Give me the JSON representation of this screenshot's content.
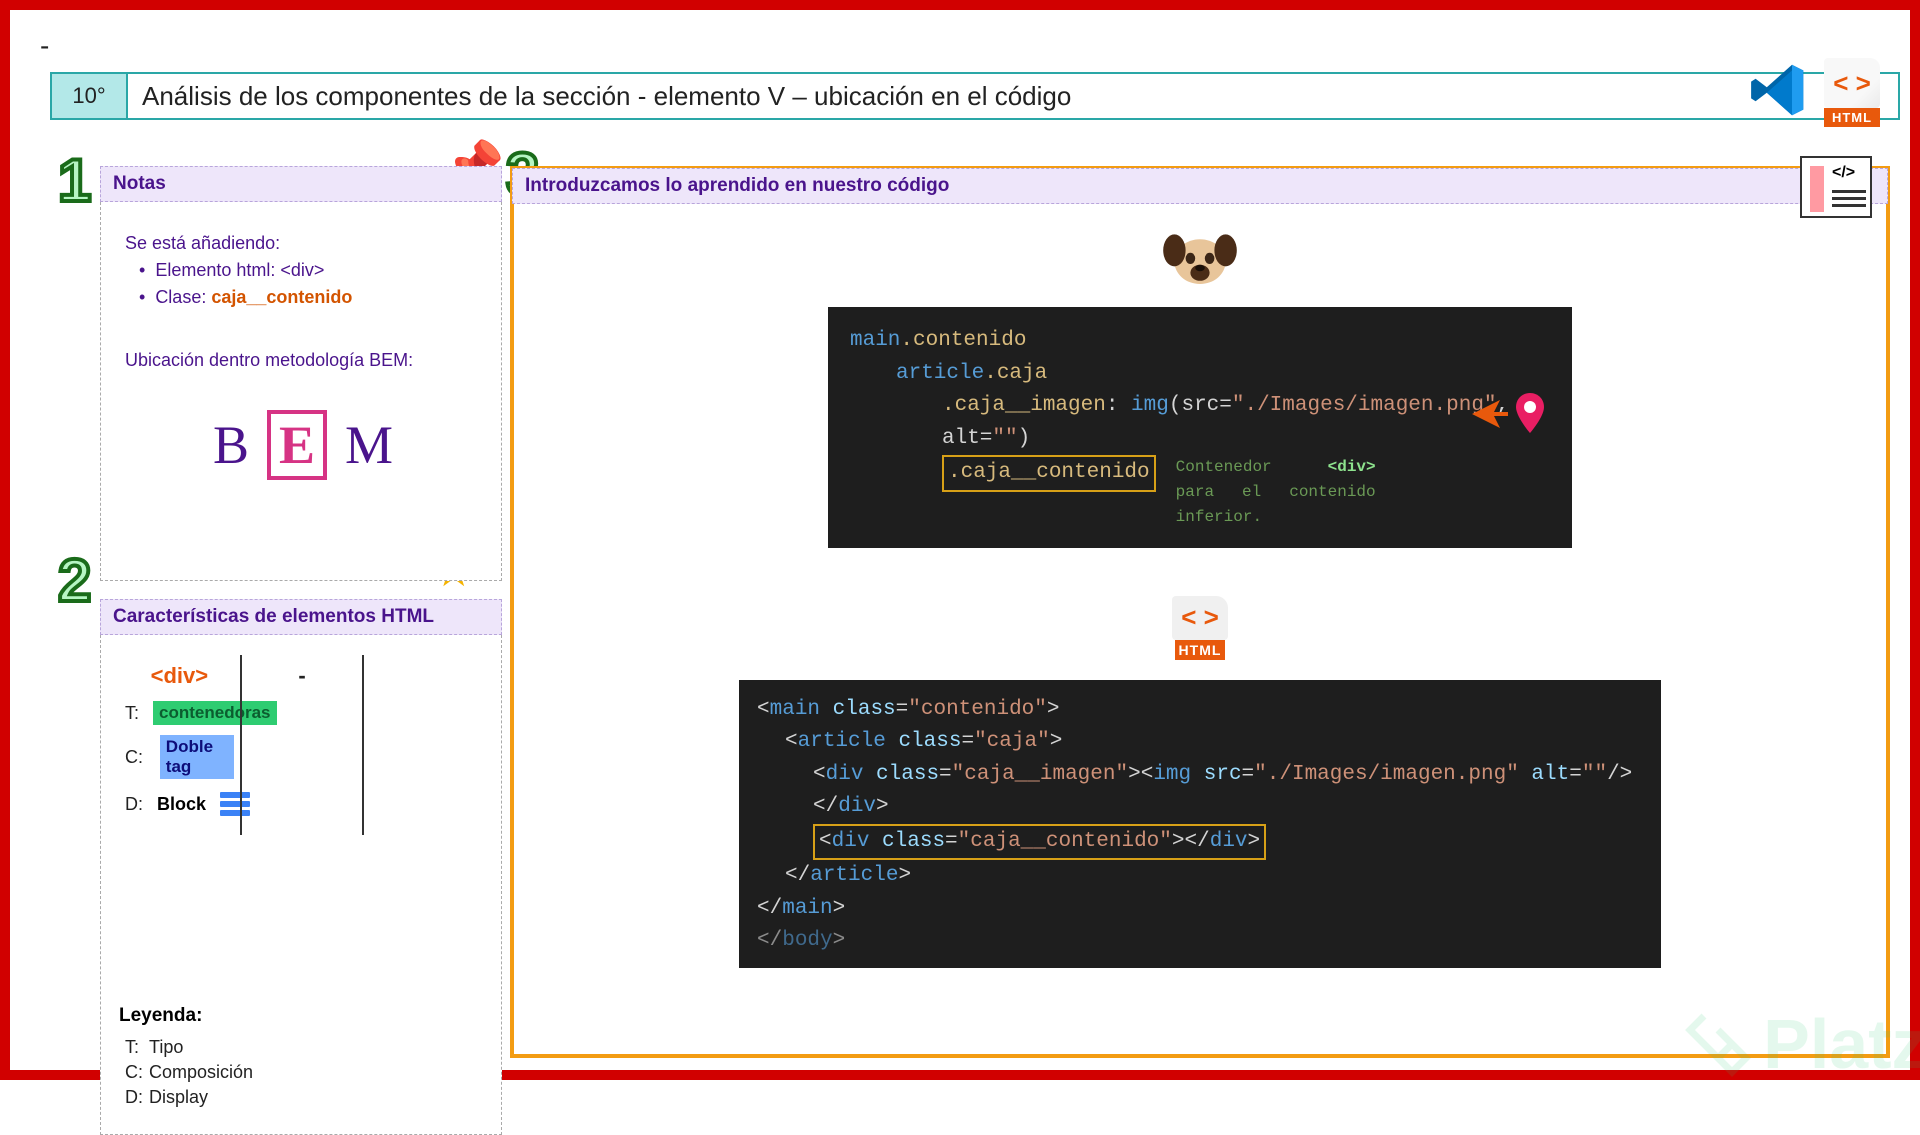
{
  "slide": {
    "dash": "-",
    "number": "10°",
    "title": "Análisis de los componentes de la sección   - elemento V – ubicación en el código"
  },
  "notas": {
    "header": "Notas",
    "intro": "Se está añadiendo:",
    "bullet1_pre": "Elemento html: ",
    "bullet1_tag": "<div>",
    "bullet2_pre": "Clase: ",
    "bullet2_val": "caja__contenido",
    "bem_label": "Ubicación dentro metodología BEM:",
    "bem_b": "B",
    "bem_e": "E",
    "bem_m": "M"
  },
  "caract": {
    "header": "Características de elementos HTML",
    "col1_tag": "<div>",
    "col2_tag": "-",
    "rows": {
      "t_key": "T:",
      "t_val": "contenedoras",
      "c_key": "C:",
      "c_val": "Doble tag",
      "d_key": "D:",
      "d_val": "Block"
    },
    "legend": {
      "title": "Leyenda:",
      "t": "Tipo",
      "c": "Composición",
      "d": "Display",
      "t_k": "T:",
      "c_k": "C:",
      "d_k": "D:"
    }
  },
  "right": {
    "header": "Introduzcamos lo aprendido en nuestro código",
    "code1": {
      "l1_a": "main",
      "l1_b": ".contenido",
      "l2_a": "article",
      "l2_b": ".caja",
      "l3_a": ".caja__imagen",
      "l3_b": ": ",
      "l3_c": "img",
      "l3_d": "(src=",
      "l3_e": "\"./Images/imagen.png\"",
      "l3_f": ", alt=",
      "l3_g": "\"\"",
      "l3_h": ")",
      "l4": ".caja__contenido",
      "cmt1": "Contenedor ",
      "cmt2": "<div>",
      "cmt3": " para el contenido inferior."
    },
    "html_label": "HTML",
    "code2": {
      "l1": "<main class=\"contenido\">",
      "l2": "  <article class=\"caja\">",
      "l3": "    <div class=\"caja__imagen\"><img src=\"./Images/imagen.png\" alt=\"\"/></div>",
      "l4": "    <div class=\"caja__contenido\"></div>",
      "l5": "  </article>",
      "l6": "</main>",
      "l7": "</body>"
    }
  },
  "watermark": "Platzi"
}
